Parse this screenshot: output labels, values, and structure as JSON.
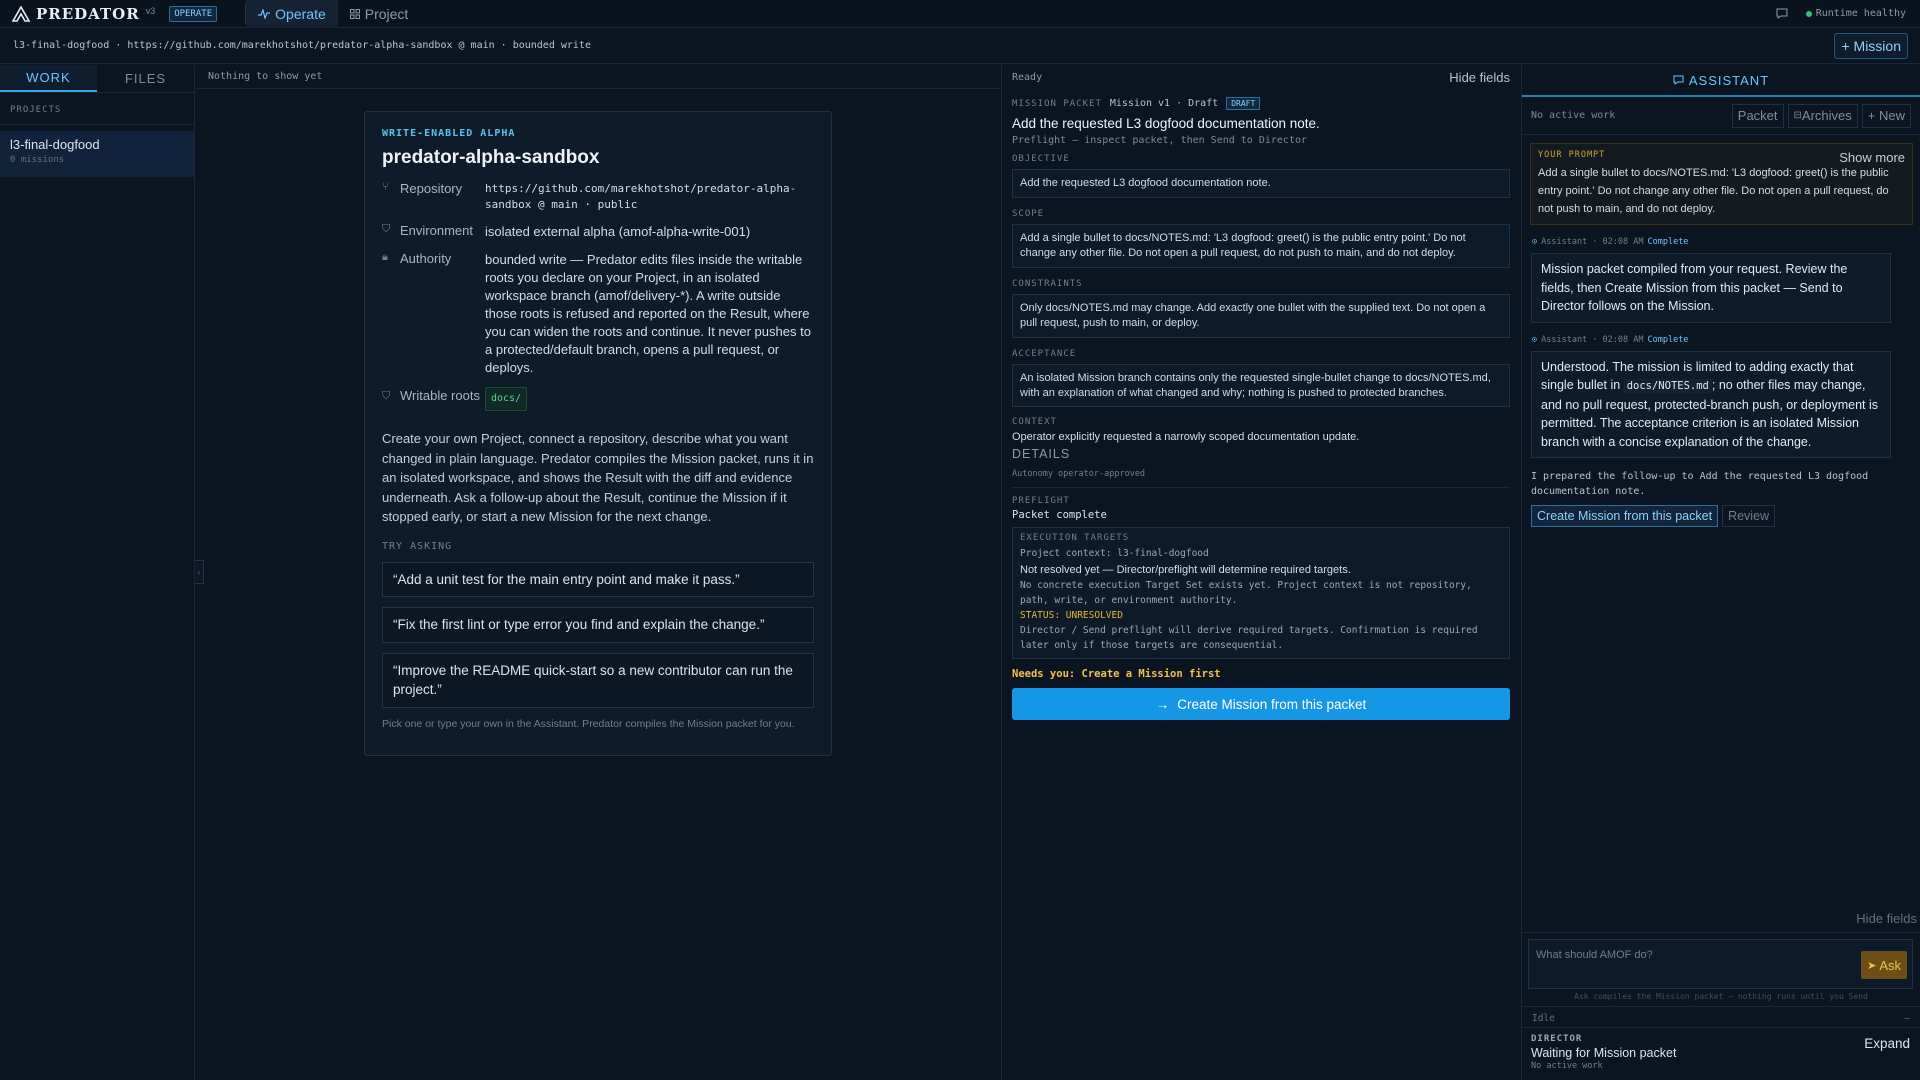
{
  "app": {
    "brand": "PREDATOR",
    "version": "v3",
    "mode_badge": "OPERATE",
    "tabs": [
      {
        "label": "Operate",
        "icon": "activity-icon",
        "active": true
      },
      {
        "label": "Project",
        "icon": "grid-icon",
        "active": false
      }
    ],
    "runtime_status": "Runtime healthy",
    "colors": {
      "accent": "#1597e5",
      "healthy": "#34c27a",
      "warning": "#f0c24a"
    }
  },
  "breadcrumb": {
    "text": "l3-final-dogfood · https://github.com/marekhotshot/predator-alpha-sandbox @ main · bounded write",
    "mission_button": "+ Mission"
  },
  "sidebar": {
    "tabs": [
      "WORK",
      "FILES"
    ],
    "section_title": "PROJECTS",
    "projects": [
      {
        "name": "l3-final-dogfood",
        "sub": "0 missions"
      }
    ]
  },
  "center": {
    "header": "Nothing to show yet",
    "card": {
      "eyebrow": "WRITE-ENABLED ALPHA",
      "title": "predator-alpha-sandbox",
      "rows": [
        {
          "key": "Repository",
          "icon": "branch-icon",
          "value": "https://github.com/marekhotshot/predator-alpha-sandbox @ main · public"
        },
        {
          "key": "Environment",
          "icon": "shield-icon",
          "value": "isolated external alpha (amof-alpha-write-001)"
        },
        {
          "key": "Authority",
          "icon": "lock-icon",
          "value": "bounded write — Predator edits files inside the writable roots you declare on your Project, in an isolated workspace branch (amof/delivery-*). A write outside those roots is refused and reported on the Result, where you can widen the roots and continue. It never pushes to a protected/default branch, opens a pull request, or deploys."
        },
        {
          "key": "Writable roots",
          "icon": "shield-icon",
          "value": "docs/"
        }
      ],
      "description": "Create your own Project, connect a repository, describe what you want changed in plain language. Predator compiles the Mission packet, runs it in an isolated workspace, and shows the Result with the diff and evidence underneath. Ask a follow-up about the Result, continue the Mission if it stopped early, or start a new Mission for the next change.",
      "try_title": "TRY ASKING",
      "suggestions": [
        "“Add a unit test for the main entry point and make it pass.”",
        "“Fix the first lint or type error you find and explain the change.”",
        "“Improve the README quick-start so a new contributor can run the project.”"
      ],
      "footnote": "Pick one or type your own in the Assistant. Predator compiles the Mission packet for you."
    }
  },
  "packet": {
    "status": "Ready",
    "hide_fields": "Hide fields",
    "label": "MISSION PACKET",
    "version": "Mission v1 · Draft",
    "badge": "DRAFT",
    "title": "Add the requested L3 dogfood documentation note.",
    "subtitle": "Preflight — inspect packet, then Send to Director",
    "fields": {
      "objective_label": "OBJECTIVE",
      "objective": "Add the requested L3 dogfood documentation note.",
      "scope_label": "SCOPE",
      "scope": "Add a single bullet to docs/NOTES.md: 'L3 dogfood: greet() is the public entry point.' Do not change any other file. Do not open a pull request, do not push to main, and do not deploy.",
      "constraints_label": "CONSTRAINTS",
      "constraints": "Only docs/NOTES.md may change. Add exactly one bullet with the supplied text. Do not open a pull request, push to main, or deploy.",
      "acceptance_label": "ACCEPTANCE",
      "acceptance": "An isolated Mission branch contains only the requested single-bullet change to docs/NOTES.md, with an explanation of what changed and why; nothing is pushed to protected branches.",
      "context_label": "CONTEXT",
      "context": "Operator explicitly requested a narrowly scoped documentation update."
    },
    "details_label": "DETAILS",
    "autonomy": "Autonomy operator-approved",
    "preflight_label": "PREFLIGHT",
    "preflight_status": "Packet complete",
    "execution": {
      "label": "EXECUTION TARGETS",
      "project_context": "Project context: l3-final-dogfood",
      "resolution": "Not resolved yet — Director/preflight will determine required targets.",
      "note": "No concrete execution Target Set exists yet. Project context is not repository, path, write, or environment authority.",
      "status": "STATUS: UNRESOLVED",
      "derive": "Director / Send preflight will derive required targets. Confirmation is required later only if those targets are consequential."
    },
    "needs_you": "Needs you: Create a Mission first",
    "primary_button": "Create Mission from this packet"
  },
  "assistant": {
    "title": "ASSISTANT",
    "no_active_work": "No active work",
    "toolbar": [
      "Packet",
      "Archives",
      "+ New"
    ],
    "prompt_label": "YOUR PROMPT",
    "show_more": "Show more",
    "prompt": "Add a single bullet to docs/NOTES.md: 'L3 dogfood: greet() is the public entry point.' Do not change any other file. Do not open a pull request, do not push to main, and do not deploy.",
    "messages": [
      {
        "author": "Assistant · 02:08 AM",
        "status": "Complete",
        "text": "Mission packet compiled from your request. Review the fields, then Create Mission from this packet — Send to Director follows on the Mission."
      },
      {
        "author": "Assistant · 02:08 AM",
        "status": "Complete",
        "text_before": "Understood. The mission is limited to adding exactly that single bullet in ",
        "code": "docs/NOTES.md",
        "text_after": "; no other files may change, and no pull request, protected-branch push, or deployment is permitted. The acceptance criterion is an isolated Mission branch with a concise explanation of the change."
      }
    ],
    "followup": "I prepared the follow-up to Add the requested L3 dogfood documentation note.",
    "followup_primary": "Create Mission from this packet",
    "followup_secondary": "Review",
    "hide_fields": "Hide fields",
    "input_placeholder": "What should AMOF do?",
    "ask_button": "Ask",
    "compose_hint": "Ask compiles the Mission packet — nothing runs until you Send",
    "idle": "Idle",
    "idle_marker": "–",
    "director_label": "DIRECTOR",
    "director_status": "Waiting for Mission packet",
    "director_sub": "No active work",
    "expand": "Expand"
  }
}
